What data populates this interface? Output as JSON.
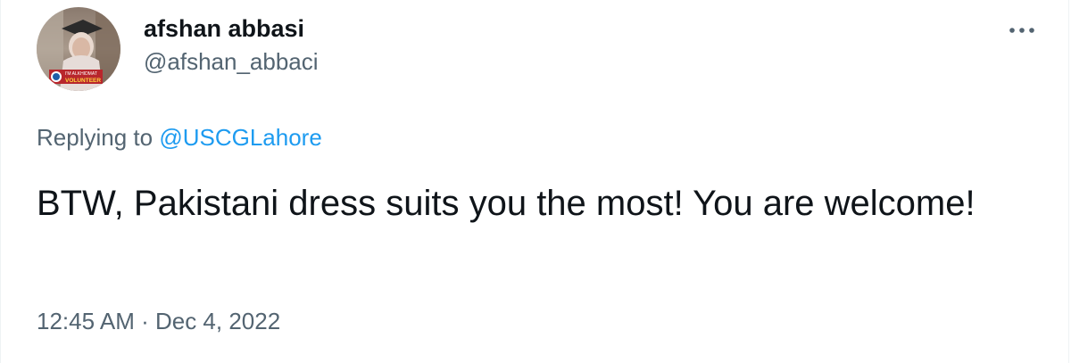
{
  "author": {
    "display_name": "afshan abbasi",
    "handle": "@afshan_abbaci",
    "avatar_badge_line1": "I'M ALKHIDMAT",
    "avatar_badge_line2": "VOLUNTEER"
  },
  "reply": {
    "prefix": "Replying to ",
    "mention": "@USCGLahore"
  },
  "tweet": {
    "text": "BTW, Pakistani dress suits you the most! You are welcome!"
  },
  "meta": {
    "time": "12:45 AM",
    "separator": " · ",
    "date": "Dec 4, 2022"
  },
  "icons": {
    "more": "more-horizontal-icon"
  },
  "colors": {
    "text_primary": "#0f1419",
    "text_secondary": "#536471",
    "link": "#1d9bf0",
    "border": "#eff3f4"
  }
}
